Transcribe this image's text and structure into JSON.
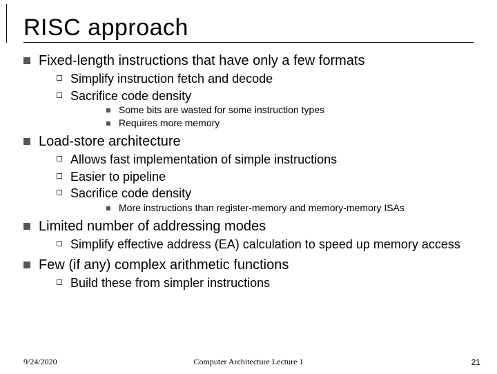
{
  "title": "RISC approach",
  "bullets": {
    "a": {
      "text": "Fixed-length instructions that have only a few formats",
      "sub": {
        "a": "Simplify instruction fetch and decode",
        "b": {
          "text": "Sacrifice code density",
          "sub": {
            "a": "Some bits are wasted for some instruction types",
            "b": "Requires more memory"
          }
        }
      }
    },
    "b": {
      "text": "Load-store architecture",
      "sub": {
        "a": "Allows fast implementation of simple instructions",
        "b": "Easier to pipeline",
        "c": {
          "text": "Sacrifice code density",
          "sub": {
            "a": "More instructions than register-memory and memory-memory ISAs"
          }
        }
      }
    },
    "c": {
      "text": "Limited number of addressing modes",
      "sub": {
        "a": "Simplify effective address (EA) calculation to speed up memory access"
      }
    },
    "d": {
      "text": "Few (if any) complex arithmetic functions",
      "sub": {
        "a": "Build these from simpler instructions"
      }
    }
  },
  "footer": {
    "date": "9/24/2020",
    "center": "Computer Architecture Lecture 1",
    "page": "21"
  }
}
